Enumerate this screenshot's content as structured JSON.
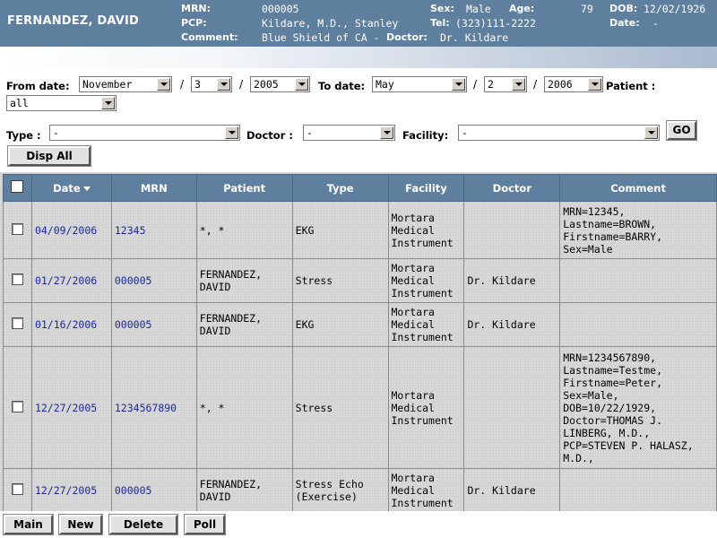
{
  "patient": {
    "name": "FERNANDEZ, DAVID",
    "mrn_label": "MRN:",
    "mrn": "000005",
    "pcp_label": "PCP:",
    "pcp": "Kildare, M.D., Stanley",
    "comment_label": "Comment:",
    "comment": "Blue Shield of CA -",
    "doctor_label": "Doctor:",
    "doctor": "Dr. Kildare",
    "sex_label": "Sex:",
    "sex": "Male",
    "age_label": "Age:",
    "age": "79",
    "dob_label": "DOB:",
    "dob": "12/02/1926",
    "tel_label": "Tel:",
    "tel": "(323)111-2222",
    "date_label": "Date:",
    "date": "-"
  },
  "filters": {
    "from_label": "From date:",
    "from_month": "November",
    "from_day": "3",
    "from_year": "2005",
    "to_label": "To date:",
    "to_month": "May",
    "to_day": "2",
    "to_year": "2006",
    "patient_label": "Patient :",
    "patient_value": "all",
    "type_label": "Type :",
    "type_value": "-",
    "doctor_label": "Doctor :",
    "doctor_value": "-",
    "facility_label": "Facility:",
    "facility_value": "-",
    "go_label": "GO",
    "disp_all_label": "Disp All",
    "slash": "/"
  },
  "table": {
    "headers": {
      "date": "Date",
      "mrn": "MRN",
      "patient": "Patient",
      "type": "Type",
      "facility": "Facility",
      "doctor": "Doctor",
      "comment": "Comment"
    },
    "rows": [
      {
        "date": "04/09/2006",
        "mrn": "12345",
        "patient": "*, *",
        "type": "EKG",
        "facility": "Mortara Medical Instrument",
        "doctor": "",
        "comment": "MRN=12345, Lastname=BROWN, Firstname=BARRY, Sex=Male"
      },
      {
        "date": "01/27/2006",
        "mrn": "000005",
        "patient": "FERNANDEZ, DAVID",
        "type": "Stress",
        "facility": "Mortara Medical Instrument",
        "doctor": "Dr. Kildare",
        "comment": ""
      },
      {
        "date": "01/16/2006",
        "mrn": "000005",
        "patient": "FERNANDEZ, DAVID",
        "type": "EKG",
        "facility": "Mortara Medical Instrument",
        "doctor": "Dr. Kildare",
        "comment": ""
      },
      {
        "date": "12/27/2005",
        "mrn": "1234567890",
        "patient": "*, *",
        "type": "Stress",
        "facility": "Mortara Medical Instrument",
        "doctor": "",
        "comment": "MRN=1234567890, Lastname=Testme, Firstname=Peter, Sex=Male, DOB=10/22/1929, Doctor=THOMAS J. LINBERG, M.D., PCP=STEVEN P. HALASZ, M.D.,"
      },
      {
        "date": "12/27/2005",
        "mrn": "000005",
        "patient": "FERNANDEZ, DAVID",
        "type": "Stress Echo (Exercise)",
        "facility": "Mortara Medical Instrument",
        "doctor": "Dr. Kildare",
        "comment": ""
      }
    ]
  },
  "actions": {
    "main": "Main",
    "new": "New",
    "delete": "Delete",
    "poll": "Poll"
  },
  "colors": {
    "header_bg": "#5f7f9f",
    "link": "#1a2a9a"
  }
}
